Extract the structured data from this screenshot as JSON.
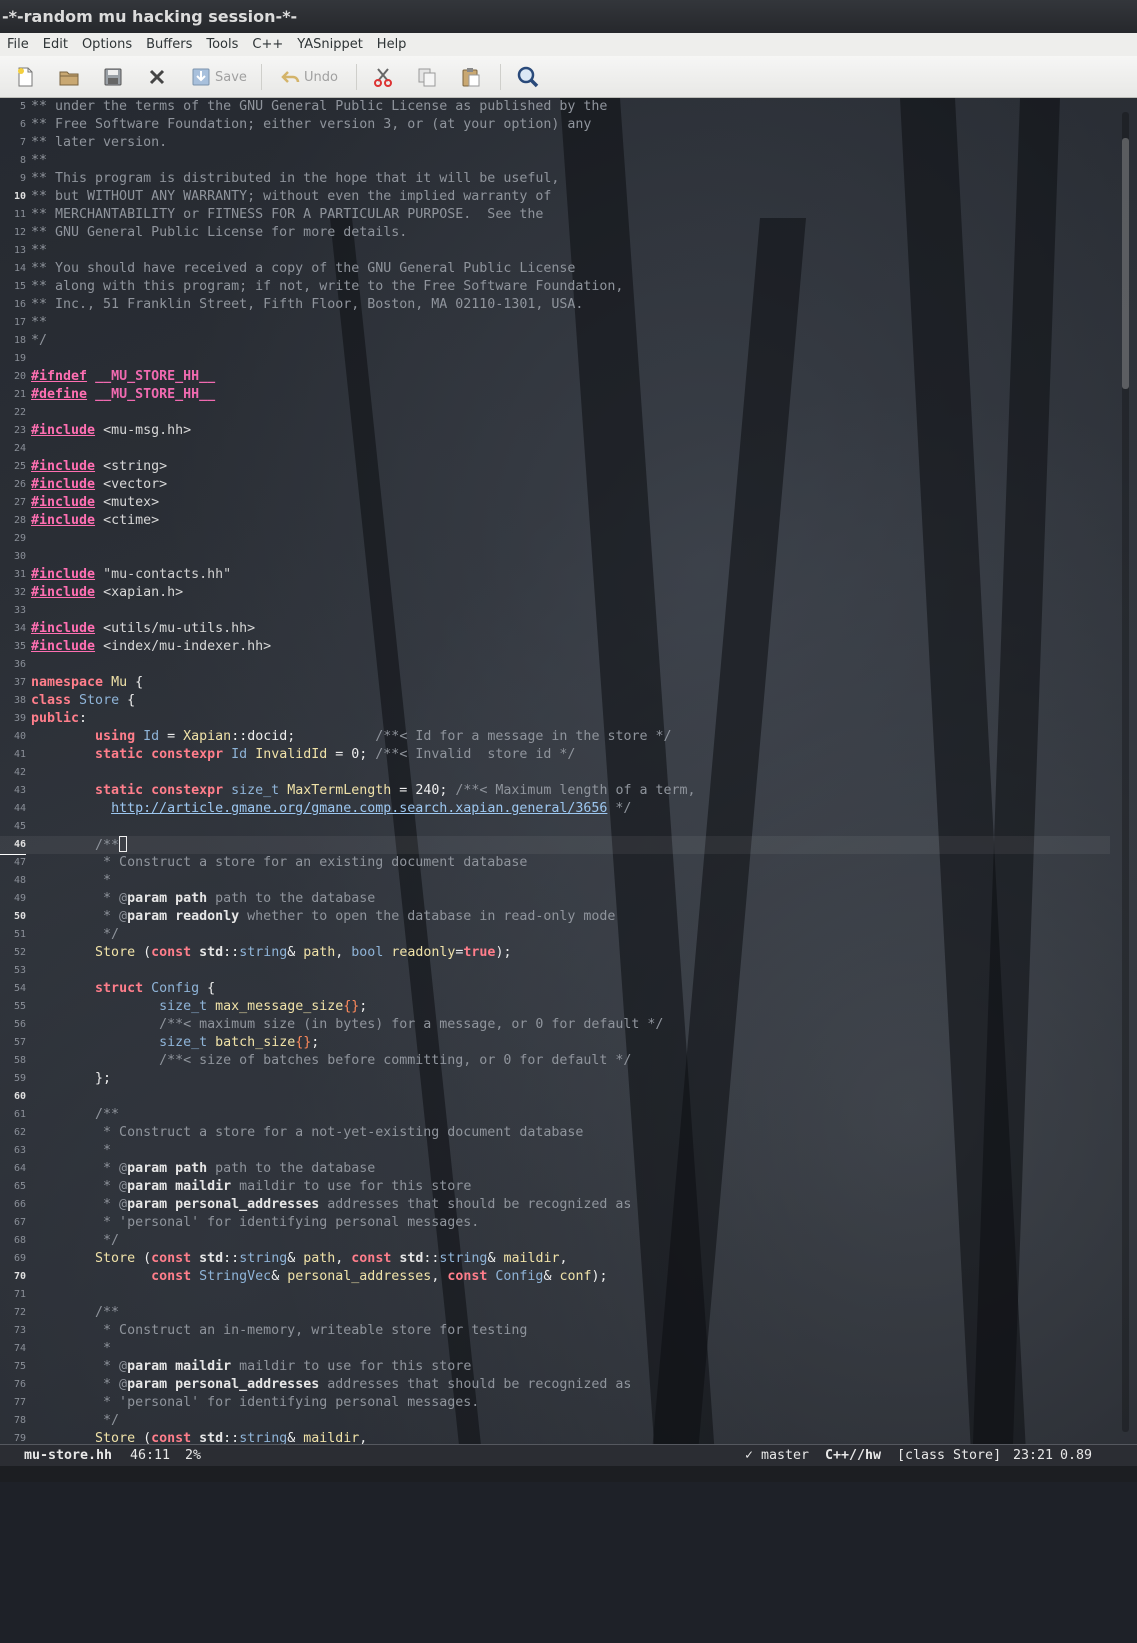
{
  "window": {
    "title": "-*-random mu hacking session-*-"
  },
  "menu": [
    "File",
    "Edit",
    "Options",
    "Buffers",
    "Tools",
    "C++",
    "YASnippet",
    "Help"
  ],
  "toolbar": {
    "save_label": "Save",
    "undo_label": "Undo",
    "icons": [
      "new-file-icon",
      "open-folder-icon",
      "save-disk-icon",
      "close-icon",
      "save-icon",
      "undo-icon",
      "cut-icon",
      "copy-icon",
      "paste-icon",
      "search-icon"
    ]
  },
  "editor": {
    "first_line": 5,
    "current_line": 46,
    "bold_line_numbers": [
      10,
      46,
      50,
      60,
      70
    ],
    "lines": [
      [
        [
          "c",
          "** under the terms of the GNU General Public License as published by the"
        ]
      ],
      [
        [
          "c",
          "** Free Software Foundation; either version 3, or (at your option) any"
        ]
      ],
      [
        [
          "c",
          "** later version."
        ]
      ],
      [
        [
          "c",
          "**"
        ]
      ],
      [
        [
          "c",
          "** This program is distributed in the hope that it will be useful,"
        ]
      ],
      [
        [
          "c",
          "** but WITHOUT ANY WARRANTY; without even the implied warranty of"
        ]
      ],
      [
        [
          "c",
          "** MERCHANTABILITY or FITNESS FOR A PARTICULAR PURPOSE.  See the"
        ]
      ],
      [
        [
          "c",
          "** GNU General Public License for more details."
        ]
      ],
      [
        [
          "c",
          "**"
        ]
      ],
      [
        [
          "c",
          "** You should have received a copy of the GNU General Public License"
        ]
      ],
      [
        [
          "c",
          "** along with this program; if not, write to the Free Software Foundation,"
        ]
      ],
      [
        [
          "c",
          "** Inc., 51 Franklin Street, Fifth Floor, Boston, MA 02110-1301, USA."
        ]
      ],
      [
        [
          "c",
          "**"
        ]
      ],
      [
        [
          "c",
          "*/"
        ]
      ],
      [],
      [
        [
          "pp",
          "#ifndef"
        ],
        [
          "t",
          " "
        ],
        [
          "ifd",
          "__MU_STORE_HH__"
        ]
      ],
      [
        [
          "pp",
          "#define"
        ],
        [
          "t",
          " "
        ],
        [
          "ifd",
          "__MU_STORE_HH__"
        ]
      ],
      [],
      [
        [
          "pp",
          "#include"
        ],
        [
          "t",
          " "
        ],
        [
          "inc",
          "<mu-msg.hh>"
        ]
      ],
      [],
      [
        [
          "pp",
          "#include"
        ],
        [
          "t",
          " "
        ],
        [
          "inc",
          "<string>"
        ]
      ],
      [
        [
          "pp",
          "#include"
        ],
        [
          "t",
          " "
        ],
        [
          "inc",
          "<vector>"
        ]
      ],
      [
        [
          "pp",
          "#include"
        ],
        [
          "t",
          " "
        ],
        [
          "inc",
          "<mutex>"
        ]
      ],
      [
        [
          "pp",
          "#include"
        ],
        [
          "t",
          " "
        ],
        [
          "inc",
          "<ctime>"
        ]
      ],
      [],
      [],
      [
        [
          "pp",
          "#include"
        ],
        [
          "t",
          " "
        ],
        [
          "st",
          "\"mu-contacts.hh\""
        ]
      ],
      [
        [
          "pp",
          "#include"
        ],
        [
          "t",
          " "
        ],
        [
          "inc",
          "<xapian.h>"
        ]
      ],
      [],
      [
        [
          "pp",
          "#include"
        ],
        [
          "t",
          " "
        ],
        [
          "inc",
          "<utils/mu-utils.hh>"
        ]
      ],
      [
        [
          "pp",
          "#include"
        ],
        [
          "t",
          " "
        ],
        [
          "inc",
          "<index/mu-indexer.hh>"
        ]
      ],
      [],
      [
        [
          "kw",
          "namespace"
        ],
        [
          "t",
          " "
        ],
        [
          "fn",
          "Mu"
        ],
        [
          "t",
          " {"
        ]
      ],
      [
        [
          "kw",
          "class"
        ],
        [
          "t",
          " "
        ],
        [
          "ty",
          "Store"
        ],
        [
          "t",
          " {"
        ]
      ],
      [
        [
          "kw",
          "public"
        ],
        [
          "t",
          ":"
        ]
      ],
      [
        [
          "t",
          "        "
        ],
        [
          "kw",
          "using"
        ],
        [
          "t",
          " "
        ],
        [
          "ty",
          "Id"
        ],
        [
          "t",
          " = "
        ],
        [
          "fn",
          "Xapian"
        ],
        [
          "t",
          "::docid;          "
        ],
        [
          "c",
          "/**< Id for a message in the store */"
        ]
      ],
      [
        [
          "t",
          "        "
        ],
        [
          "kw",
          "static constexpr"
        ],
        [
          "t",
          " "
        ],
        [
          "ty",
          "Id"
        ],
        [
          "t",
          " "
        ],
        [
          "fn",
          "InvalidId"
        ],
        [
          "t",
          " = 0; "
        ],
        [
          "c",
          "/**< Invalid  store id */"
        ]
      ],
      [],
      [
        [
          "t",
          "        "
        ],
        [
          "kw",
          "static constexpr"
        ],
        [
          "t",
          " "
        ],
        [
          "ty",
          "size_t"
        ],
        [
          "t",
          " "
        ],
        [
          "fn",
          "MaxTermLength"
        ],
        [
          "t",
          " = 240; "
        ],
        [
          "c",
          "/**< Maximum length of a term,"
        ]
      ],
      [
        [
          "t",
          "          "
        ],
        [
          "link",
          "http://article.gmane.org/gmane.comp.search.xapian.general/3656"
        ],
        [
          "c",
          " */"
        ]
      ],
      [],
      [
        [
          "t",
          "        "
        ],
        [
          "c",
          "/**"
        ],
        [
          "cursor",
          ""
        ]
      ],
      [
        [
          "c",
          "         * Construct a store for an existing document database"
        ]
      ],
      [
        [
          "c",
          "         *"
        ]
      ],
      [
        [
          "c",
          "         * @"
        ],
        [
          "cb",
          "param path"
        ],
        [
          "c",
          " path to the database"
        ]
      ],
      [
        [
          "c",
          "         * @"
        ],
        [
          "cb",
          "param readonly"
        ],
        [
          "c",
          " whether to open the database in read-only mode"
        ]
      ],
      [
        [
          "c",
          "         */"
        ]
      ],
      [
        [
          "t",
          "        "
        ],
        [
          "fn",
          "Store"
        ],
        [
          "t",
          " ("
        ],
        [
          "kw",
          "const"
        ],
        [
          "t",
          " "
        ],
        [
          "cb",
          "std"
        ],
        [
          "t",
          "::"
        ],
        [
          "ty",
          "string"
        ],
        [
          "t",
          "& "
        ],
        [
          "fn",
          "path"
        ],
        [
          "t",
          ", "
        ],
        [
          "ty",
          "bool"
        ],
        [
          "t",
          " "
        ],
        [
          "fn",
          "readonly"
        ],
        [
          "t",
          "="
        ],
        [
          "kw",
          "true"
        ],
        [
          "t",
          ");"
        ]
      ],
      [],
      [
        [
          "t",
          "        "
        ],
        [
          "kw",
          "struct"
        ],
        [
          "t",
          " "
        ],
        [
          "ty",
          "Config"
        ],
        [
          "t",
          " {"
        ]
      ],
      [
        [
          "t",
          "                "
        ],
        [
          "ty",
          "size_t"
        ],
        [
          "t",
          " "
        ],
        [
          "fn",
          "max_message_size"
        ],
        [
          "br",
          "{}"
        ],
        [
          "t",
          ";"
        ]
      ],
      [
        [
          "t",
          "                "
        ],
        [
          "c",
          "/**< maximum size (in bytes) for a message, or 0 for default */"
        ]
      ],
      [
        [
          "t",
          "                "
        ],
        [
          "ty",
          "size_t"
        ],
        [
          "t",
          " "
        ],
        [
          "fn",
          "batch_size"
        ],
        [
          "br",
          "{}"
        ],
        [
          "t",
          ";"
        ]
      ],
      [
        [
          "t",
          "                "
        ],
        [
          "c",
          "/**< size of batches before committing, or 0 for default */"
        ]
      ],
      [
        [
          "t",
          "        };"
        ]
      ],
      [],
      [
        [
          "t",
          "        "
        ],
        [
          "c",
          "/**"
        ]
      ],
      [
        [
          "c",
          "         * Construct a store for a not-yet-existing document database"
        ]
      ],
      [
        [
          "c",
          "         *"
        ]
      ],
      [
        [
          "c",
          "         * @"
        ],
        [
          "cb",
          "param path"
        ],
        [
          "c",
          " path to the database"
        ]
      ],
      [
        [
          "c",
          "         * @"
        ],
        [
          "cb",
          "param maildir"
        ],
        [
          "c",
          " maildir to use for this store"
        ]
      ],
      [
        [
          "c",
          "         * @"
        ],
        [
          "cb",
          "param personal_addresses"
        ],
        [
          "c",
          " addresses that should be recognized as"
        ]
      ],
      [
        [
          "c",
          "         * 'personal' for identifying personal messages."
        ]
      ],
      [
        [
          "c",
          "         */"
        ]
      ],
      [
        [
          "t",
          "        "
        ],
        [
          "fn",
          "Store"
        ],
        [
          "t",
          " ("
        ],
        [
          "kw",
          "const"
        ],
        [
          "t",
          " "
        ],
        [
          "cb",
          "std"
        ],
        [
          "t",
          "::"
        ],
        [
          "ty",
          "string"
        ],
        [
          "t",
          "& "
        ],
        [
          "fn",
          "path"
        ],
        [
          "t",
          ", "
        ],
        [
          "kw",
          "const"
        ],
        [
          "t",
          " "
        ],
        [
          "cb",
          "std"
        ],
        [
          "t",
          "::"
        ],
        [
          "ty",
          "string"
        ],
        [
          "t",
          "& "
        ],
        [
          "fn",
          "maildir"
        ],
        [
          "t",
          ","
        ]
      ],
      [
        [
          "t",
          "               "
        ],
        [
          "kw",
          "const"
        ],
        [
          "t",
          " "
        ],
        [
          "ty",
          "StringVec"
        ],
        [
          "t",
          "& "
        ],
        [
          "fn",
          "personal_addresses"
        ],
        [
          "t",
          ", "
        ],
        [
          "kw",
          "const"
        ],
        [
          "t",
          " "
        ],
        [
          "ty",
          "Config"
        ],
        [
          "t",
          "& "
        ],
        [
          "fn",
          "conf"
        ],
        [
          "t",
          ");"
        ]
      ],
      [],
      [
        [
          "t",
          "        "
        ],
        [
          "c",
          "/**"
        ]
      ],
      [
        [
          "c",
          "         * Construct an in-memory, writeable store for testing"
        ]
      ],
      [
        [
          "c",
          "         *"
        ]
      ],
      [
        [
          "c",
          "         * @"
        ],
        [
          "cb",
          "param maildir"
        ],
        [
          "c",
          " maildir to use for this store"
        ]
      ],
      [
        [
          "c",
          "         * @"
        ],
        [
          "cb",
          "param personal_addresses"
        ],
        [
          "c",
          " addresses that should be recognized as"
        ]
      ],
      [
        [
          "c",
          "         * 'personal' for identifying personal messages."
        ]
      ],
      [
        [
          "c",
          "         */"
        ]
      ],
      [
        [
          "t",
          "        "
        ],
        [
          "fn",
          "Store"
        ],
        [
          "t",
          " ("
        ],
        [
          "kw",
          "const"
        ],
        [
          "t",
          " "
        ],
        [
          "cb",
          "std"
        ],
        [
          "t",
          "::"
        ],
        [
          "ty",
          "string"
        ],
        [
          "t",
          "& "
        ],
        [
          "fn",
          "maildir"
        ],
        [
          "t",
          ","
        ]
      ]
    ]
  },
  "modeline": {
    "buffer": "mu-store.hh",
    "position": "46:11",
    "percent": "2%",
    "vc": "✓ master",
    "mode": "C++//hw",
    "which_func": "[class Store]",
    "time": "23:21",
    "load": "0.89"
  },
  "scroll_fraction": 0.02,
  "colors": {
    "comment": "#8f949c",
    "preprocessor": "#ff6fb2",
    "keyword": "#ff7e8b",
    "type": "#8fb4d8",
    "function": "#f0e2a8",
    "link": "#9dc7f0"
  }
}
